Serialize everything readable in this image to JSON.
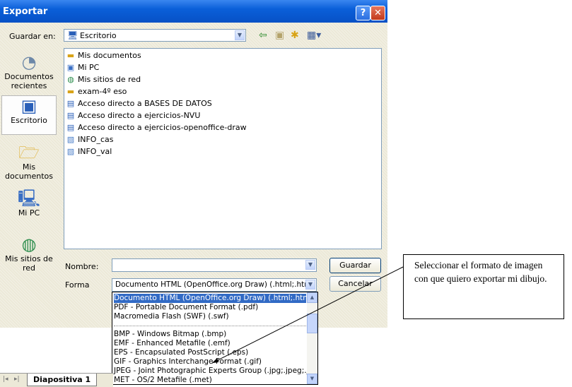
{
  "window": {
    "title": "Exportar",
    "help_label": "?",
    "close_label": "✕"
  },
  "save_in": {
    "label": "Guardar en:",
    "value": "Escritorio",
    "icon": "desktop-icon"
  },
  "toolbar": {
    "icons": [
      "back-icon",
      "up-folder-icon",
      "new-folder-icon",
      "view-menu-icon"
    ]
  },
  "places": [
    {
      "label": "Documentos recientes",
      "icon": "recent-documents-icon"
    },
    {
      "label": "Escritorio",
      "icon": "desktop-icon"
    },
    {
      "label": "Mis documentos",
      "icon": "my-documents-icon"
    },
    {
      "label": "Mi PC",
      "icon": "my-computer-icon"
    },
    {
      "label": "Mis sitios de red",
      "icon": "network-places-icon"
    }
  ],
  "files": [
    {
      "name": "Mis documentos",
      "icon": "folder-icon"
    },
    {
      "name": "Mi PC",
      "icon": "computer-icon"
    },
    {
      "name": "Mis sitios de red",
      "icon": "network-icon"
    },
    {
      "name": "exam-4º eso",
      "icon": "folder-icon"
    },
    {
      "name": "Acceso directo a BASES DE DATOS",
      "icon": "shortcut-icon"
    },
    {
      "name": "Acceso directo a ejercicios-NVU",
      "icon": "shortcut-icon"
    },
    {
      "name": "Acceso directo a ejercicios-openoffice-draw",
      "icon": "shortcut-icon"
    },
    {
      "name": "INFO_cas",
      "icon": "html-document-icon"
    },
    {
      "name": "INFO_val",
      "icon": "html-document-icon"
    }
  ],
  "form": {
    "name_label": "Nombre:",
    "name_value": "",
    "type_label": "Forma",
    "type_value": "Documento HTML (OpenOffice.org Draw) (.html;.htm)"
  },
  "buttons": {
    "save": "Guardar",
    "cancel": "Cancelar"
  },
  "format_options": [
    "Documento HTML (OpenOffice.org Draw) (.html;.htm)",
    "PDF - Portable Document Format (.pdf)",
    "Macromedia Flash (SWF) (.swf)",
    "",
    "BMP - Windows Bitmap (.bmp)",
    "EMF - Enhanced Metafile (.emf)",
    "EPS - Encapsulated PostScript (.eps)",
    "GIF - Graphics Interchange Format (.gif)",
    "JPEG - Joint Photographic Experts Group (.jpg;.jpeg;.jfif;.ji",
    "MET - OS/2 Metafile (.met)"
  ],
  "selected_format_index": 0,
  "sheet_tab": "Diapositiva 1",
  "callout": {
    "text": "Seleccionar el formato de imagen con que quiero exportar mi dibujo."
  },
  "colors": {
    "title_bar": "#0a5fd9",
    "selection": "#316ac5",
    "dialog_bg": "#ece9d8"
  }
}
